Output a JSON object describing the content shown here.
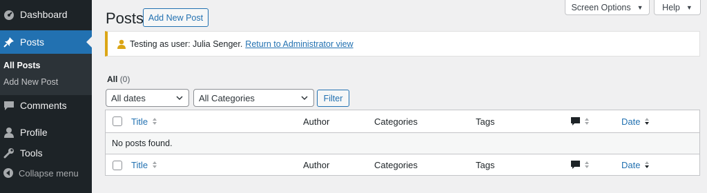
{
  "sidebar": {
    "items": [
      {
        "label": "Dashboard",
        "icon": "dashboard-icon"
      },
      {
        "label": "Posts",
        "icon": "pin-icon"
      },
      {
        "label": "Comments",
        "icon": "comment-icon"
      },
      {
        "label": "Profile",
        "icon": "user-icon"
      },
      {
        "label": "Tools",
        "icon": "wrench-icon"
      }
    ],
    "submenu": [
      "All Posts",
      "Add New Post"
    ],
    "collapse_label": "Collapse menu"
  },
  "header": {
    "title": "Posts",
    "add_new_label": "Add New Post",
    "screen_options_label": "Screen Options",
    "help_label": "Help"
  },
  "notice": {
    "text": "Testing as user: Julia Senger.",
    "link": "Return to Administrator view",
    "accent": "#dba617"
  },
  "views": {
    "all_label": "All",
    "all_count": "(0)"
  },
  "filters": {
    "dates_value": "All dates",
    "categories_value": "All Categories",
    "filter_label": "Filter"
  },
  "table": {
    "columns": {
      "title": "Title",
      "author": "Author",
      "categories": "Categories",
      "tags": "Tags",
      "date": "Date"
    },
    "empty_message": "No posts found."
  },
  "colors": {
    "sidebar": "#1d2327",
    "active": "#2271b1",
    "link": "#2271b1"
  }
}
